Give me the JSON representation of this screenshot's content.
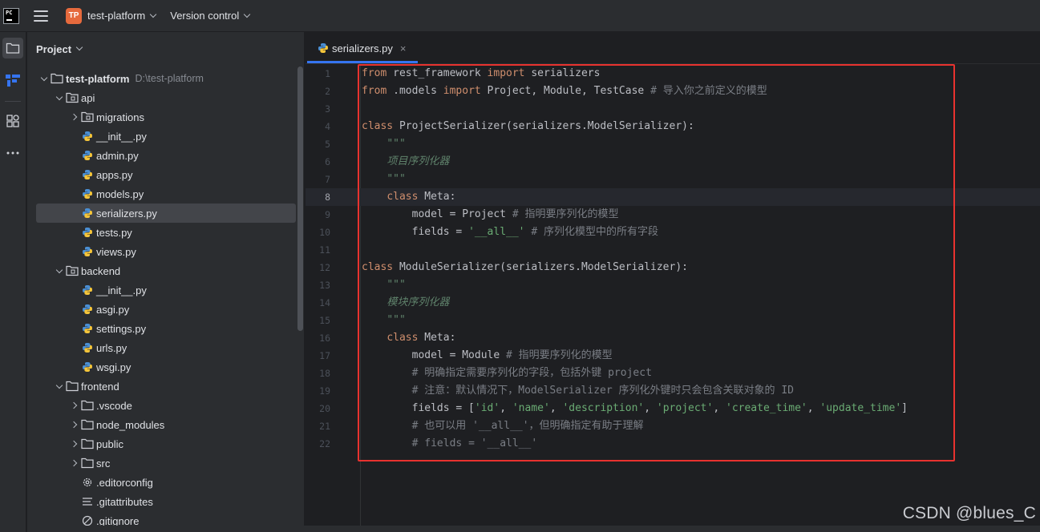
{
  "titlebar": {
    "app_logo_text": "PC",
    "project_badge": "TP",
    "project_name": "test-platform",
    "vcs_label": "Version control"
  },
  "toolstrip": {
    "icons": [
      "folder-icon",
      "structure-icon",
      "plugins-icon",
      "more-icon"
    ]
  },
  "project_panel": {
    "title": "Project",
    "root": {
      "name": "test-platform",
      "path": "D:\\test-platform"
    },
    "items": [
      {
        "label": "api",
        "type": "module-folder",
        "expanded": true
      },
      {
        "label": "migrations",
        "type": "module-folder",
        "expanded": false
      },
      {
        "label": "__init__.py",
        "type": "python"
      },
      {
        "label": "admin.py",
        "type": "python"
      },
      {
        "label": "apps.py",
        "type": "python"
      },
      {
        "label": "models.py",
        "type": "python"
      },
      {
        "label": "serializers.py",
        "type": "python",
        "selected": true
      },
      {
        "label": "tests.py",
        "type": "python"
      },
      {
        "label": "views.py",
        "type": "python"
      },
      {
        "label": "backend",
        "type": "module-folder",
        "expanded": true
      },
      {
        "label": "__init__.py",
        "type": "python"
      },
      {
        "label": "asgi.py",
        "type": "python"
      },
      {
        "label": "settings.py",
        "type": "python"
      },
      {
        "label": "urls.py",
        "type": "python"
      },
      {
        "label": "wsgi.py",
        "type": "python"
      },
      {
        "label": "frontend",
        "type": "folder",
        "expanded": true
      },
      {
        "label": ".vscode",
        "type": "folder",
        "expanded": false
      },
      {
        "label": "node_modules",
        "type": "folder",
        "expanded": false
      },
      {
        "label": "public",
        "type": "folder",
        "expanded": false
      },
      {
        "label": "src",
        "type": "folder",
        "expanded": false
      },
      {
        "label": ".editorconfig",
        "type": "gear"
      },
      {
        "label": ".gitattributes",
        "type": "lines"
      },
      {
        "label": ".gitignore",
        "type": "ignore"
      }
    ]
  },
  "editor": {
    "tab": {
      "label": "serializers.py",
      "close": "×"
    },
    "current_line": 8,
    "lines": [
      {
        "n": "1",
        "seg": [
          [
            "kw",
            "from"
          ],
          [
            "t",
            " rest_framework "
          ],
          [
            "kw",
            "import"
          ],
          [
            "t",
            " serializers"
          ]
        ]
      },
      {
        "n": "2",
        "seg": [
          [
            "kw",
            "from"
          ],
          [
            "t",
            " .models "
          ],
          [
            "kw",
            "import"
          ],
          [
            "t",
            " Project, Module, TestCase "
          ],
          [
            "cm",
            "# 导入你之前定义的模型"
          ]
        ]
      },
      {
        "n": "3",
        "seg": []
      },
      {
        "n": "4",
        "seg": [
          [
            "kw",
            "class"
          ],
          [
            "t",
            " ProjectSerializer(serializers.ModelSerializer):"
          ]
        ]
      },
      {
        "n": "5",
        "seg": [
          [
            "t",
            "    "
          ],
          [
            "doc",
            "\"\"\""
          ]
        ]
      },
      {
        "n": "6",
        "seg": [
          [
            "t",
            "    "
          ],
          [
            "doc",
            "项目序列化器"
          ]
        ]
      },
      {
        "n": "7",
        "seg": [
          [
            "t",
            "    "
          ],
          [
            "doc",
            "\"\"\""
          ]
        ]
      },
      {
        "n": "8",
        "seg": [
          [
            "t",
            "    "
          ],
          [
            "kw",
            "class"
          ],
          [
            "t",
            " Meta:"
          ]
        ]
      },
      {
        "n": "9",
        "seg": [
          [
            "t",
            "        model = Project "
          ],
          [
            "cm",
            "# 指明要序列化的模型"
          ]
        ]
      },
      {
        "n": "10",
        "seg": [
          [
            "t",
            "        fields = "
          ],
          [
            "str",
            "'__all__'"
          ],
          [
            "t",
            " "
          ],
          [
            "cm",
            "# 序列化模型中的所有字段"
          ]
        ]
      },
      {
        "n": "11",
        "seg": []
      },
      {
        "n": "12",
        "seg": [
          [
            "kw",
            "class"
          ],
          [
            "t",
            " ModuleSerializer(serializers.ModelSerializer):"
          ]
        ]
      },
      {
        "n": "13",
        "seg": [
          [
            "t",
            "    "
          ],
          [
            "doc",
            "\"\"\""
          ]
        ]
      },
      {
        "n": "14",
        "seg": [
          [
            "t",
            "    "
          ],
          [
            "doc",
            "模块序列化器"
          ]
        ]
      },
      {
        "n": "15",
        "seg": [
          [
            "t",
            "    "
          ],
          [
            "doc",
            "\"\"\""
          ]
        ]
      },
      {
        "n": "16",
        "seg": [
          [
            "t",
            "    "
          ],
          [
            "kw",
            "class"
          ],
          [
            "t",
            " Meta:"
          ]
        ]
      },
      {
        "n": "17",
        "seg": [
          [
            "t",
            "        model = Module "
          ],
          [
            "cm",
            "# 指明要序列化的模型"
          ]
        ]
      },
      {
        "n": "18",
        "seg": [
          [
            "t",
            "        "
          ],
          [
            "cm",
            "# 明确指定需要序列化的字段，包括外键 project"
          ]
        ]
      },
      {
        "n": "19",
        "seg": [
          [
            "t",
            "        "
          ],
          [
            "cm",
            "# 注意：默认情况下，ModelSerializer 序列化外键时只会包含关联对象的 ID"
          ]
        ]
      },
      {
        "n": "20",
        "seg": [
          [
            "t",
            "        fields = ["
          ],
          [
            "str",
            "'id'"
          ],
          [
            "t",
            ", "
          ],
          [
            "str",
            "'name'"
          ],
          [
            "t",
            ", "
          ],
          [
            "str",
            "'description'"
          ],
          [
            "t",
            ", "
          ],
          [
            "str",
            "'project'"
          ],
          [
            "t",
            ", "
          ],
          [
            "str",
            "'create_time'"
          ],
          [
            "t",
            ", "
          ],
          [
            "str",
            "'update_time'"
          ],
          [
            "t",
            "]"
          ]
        ]
      },
      {
        "n": "21",
        "seg": [
          [
            "t",
            "        "
          ],
          [
            "cm",
            "# 也可以用 '__all__'，但明确指定有助于理解"
          ]
        ]
      },
      {
        "n": "22",
        "seg": [
          [
            "t",
            "        "
          ],
          [
            "cm",
            "# fields = '__all__'"
          ]
        ]
      }
    ]
  },
  "watermark": "CSDN @blues_C",
  "colors": {
    "keyword": "#cf8e6d",
    "string": "#6aab73",
    "comment": "#7a7e85",
    "docstring": "#5f826b",
    "highlight_box": "#e8322f",
    "tab_accent": "#3574f0"
  }
}
